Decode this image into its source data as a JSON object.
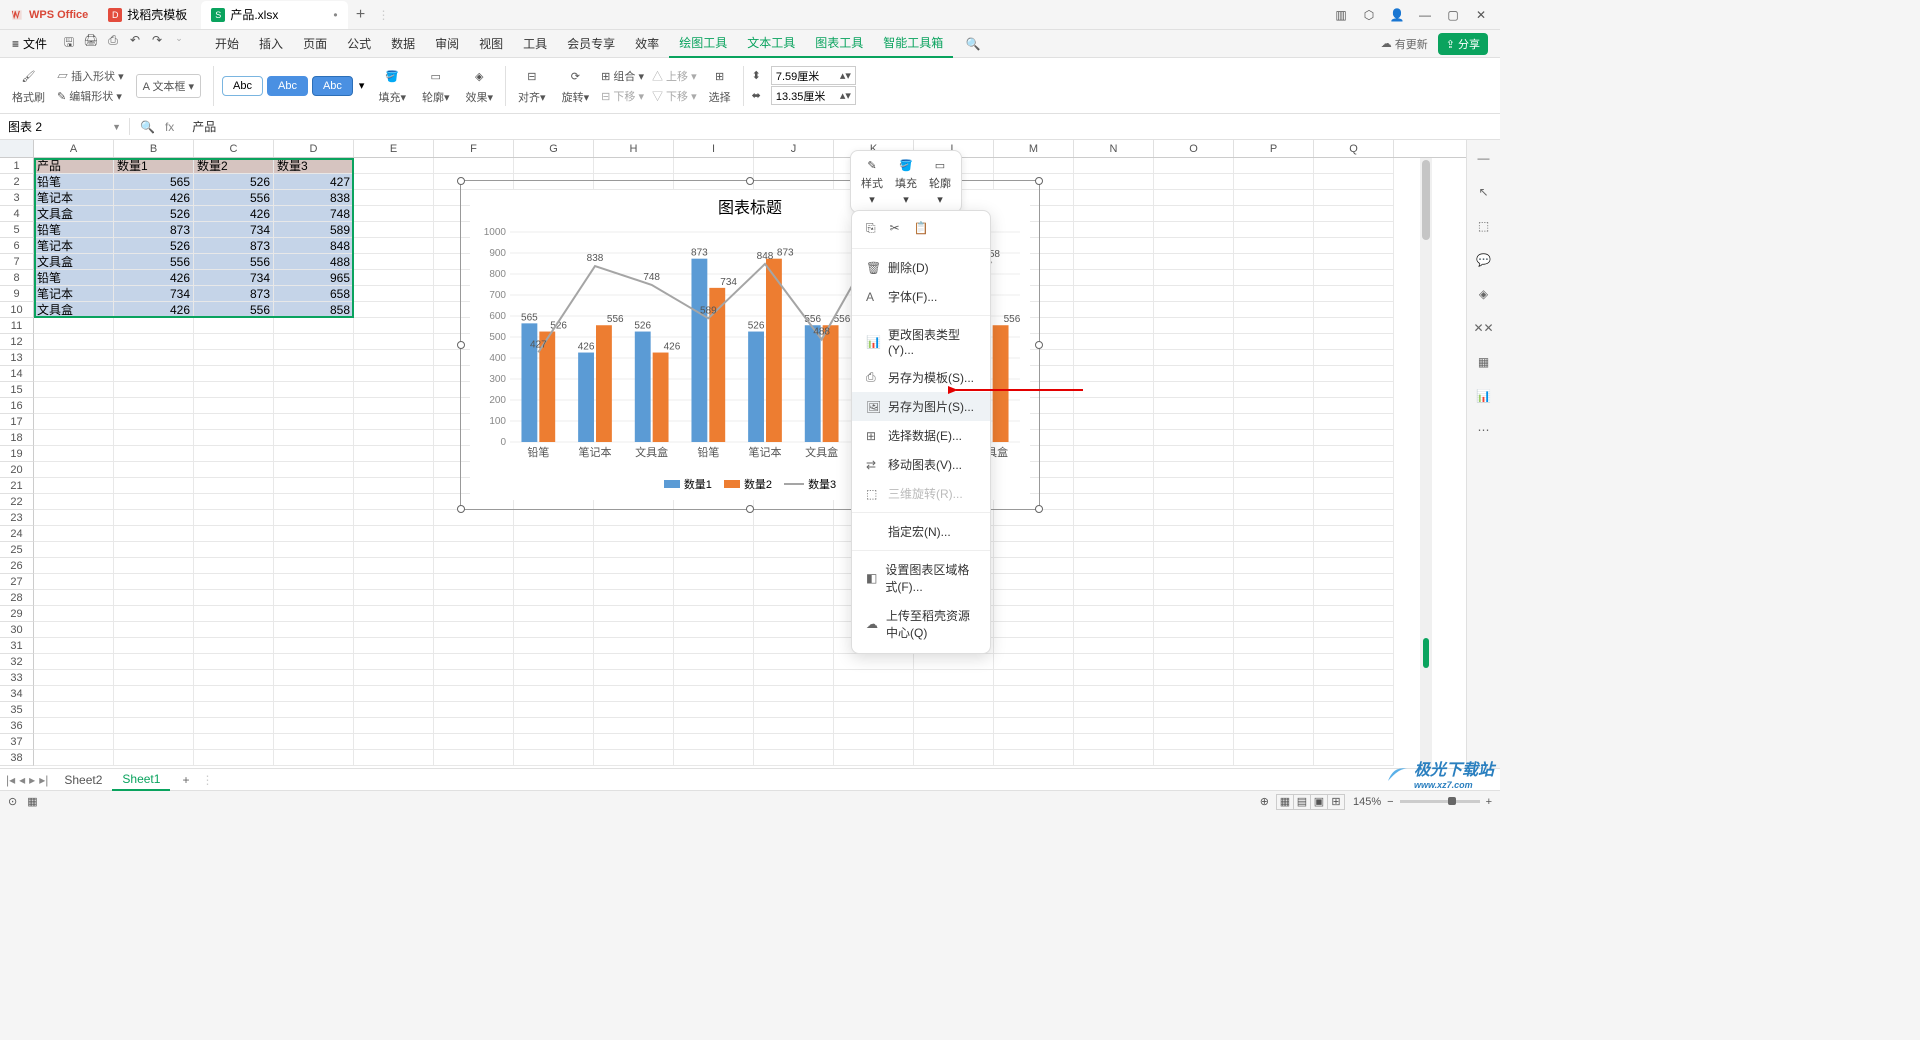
{
  "title": {
    "wps": "WPS Office",
    "tab_template": "找稻壳模板",
    "tab_file": "产品.xlsx"
  },
  "menu": {
    "file": "文件",
    "tabs": [
      "开始",
      "插入",
      "页面",
      "公式",
      "数据",
      "审阅",
      "视图",
      "工具",
      "会员专享",
      "效率",
      "绘图工具",
      "文本工具",
      "图表工具",
      "智能工具箱"
    ],
    "activeFrom": 10,
    "update": "有更新",
    "share": "分享"
  },
  "ribbon": {
    "fmtPaint": "格式刷",
    "insertShape": "插入形状",
    "textbox": "文本框",
    "editShape": "编辑形状",
    "abc": "Abc",
    "fill": "填充",
    "outline": "轮廓",
    "effect": "效果",
    "align": "对齐",
    "rotate": "旋转",
    "group": "组合",
    "moveUp": "上移",
    "moveDown": "下移",
    "movePane": "⎘",
    "select": "选择",
    "h": "7.59厘米",
    "w": "13.35厘米"
  },
  "formula": {
    "namebox": "图表 2",
    "fx": "fx",
    "value": "产品"
  },
  "cols": [
    "A",
    "B",
    "C",
    "D",
    "E",
    "F",
    "G",
    "H",
    "I",
    "J",
    "K",
    "L",
    "M",
    "N",
    "O",
    "P",
    "Q"
  ],
  "table": {
    "headers": [
      "产品",
      "数量1",
      "数量2",
      "数量3"
    ],
    "rows": [
      [
        "铅笔",
        565,
        526,
        427
      ],
      [
        "笔记本",
        426,
        556,
        838
      ],
      [
        "文具盒",
        526,
        426,
        748
      ],
      [
        "铅笔",
        873,
        734,
        589
      ],
      [
        "笔记本",
        526,
        873,
        848
      ],
      [
        "文具盒",
        556,
        556,
        488
      ],
      [
        "铅笔",
        426,
        734,
        965
      ],
      [
        "笔记本",
        734,
        873,
        658
      ],
      [
        "文具盒",
        426,
        556,
        858
      ]
    ]
  },
  "chart_data": {
    "type": "bar",
    "title": "图表标题",
    "categories": [
      "铅笔",
      "笔记本",
      "文具盒",
      "铅笔",
      "笔记本",
      "文具盒",
      "铅笔",
      "笔记本",
      "文具盒"
    ],
    "series": [
      {
        "name": "数量1",
        "values": [
          565,
          426,
          526,
          873,
          526,
          556,
          426,
          734,
          426
        ],
        "color": "#5B9BD5"
      },
      {
        "name": "数量2",
        "values": [
          526,
          556,
          426,
          734,
          873,
          556,
          734,
          873,
          556
        ],
        "color": "#ED7D31"
      },
      {
        "name": "数量3",
        "values": [
          427,
          838,
          748,
          589,
          848,
          488,
          965,
          658,
          858
        ],
        "color": "#A5A5A5",
        "chart": "line"
      }
    ],
    "ylim": [
      0,
      1000
    ],
    "ytick": 100,
    "legend": [
      "数量1",
      "数量2",
      "数量3"
    ]
  },
  "minitb": {
    "style": "样式",
    "fill": "填充",
    "outline": "轮廓"
  },
  "ctx": {
    "delete": "删除(D)",
    "font": "字体(F)...",
    "changeType": "更改图表类型(Y)...",
    "saveTemplate": "另存为模板(S)...",
    "saveImage": "另存为图片(S)...",
    "selectData": "选择数据(E)...",
    "moveChart": "移动图表(V)...",
    "rotate3d": "三维旋转(R)...",
    "assignMacro": "指定宏(N)...",
    "formatArea": "设置图表区域格式(F)...",
    "upload": "上传至稻壳资源中心(Q)"
  },
  "sheets": {
    "items": [
      "Sheet2",
      "Sheet1"
    ],
    "active": 1
  },
  "status": {
    "zoom": "145%",
    "plus": "+",
    "minus": "−"
  },
  "watermark": {
    "main": "极光下载站",
    "sub": "www.xz7.com"
  }
}
